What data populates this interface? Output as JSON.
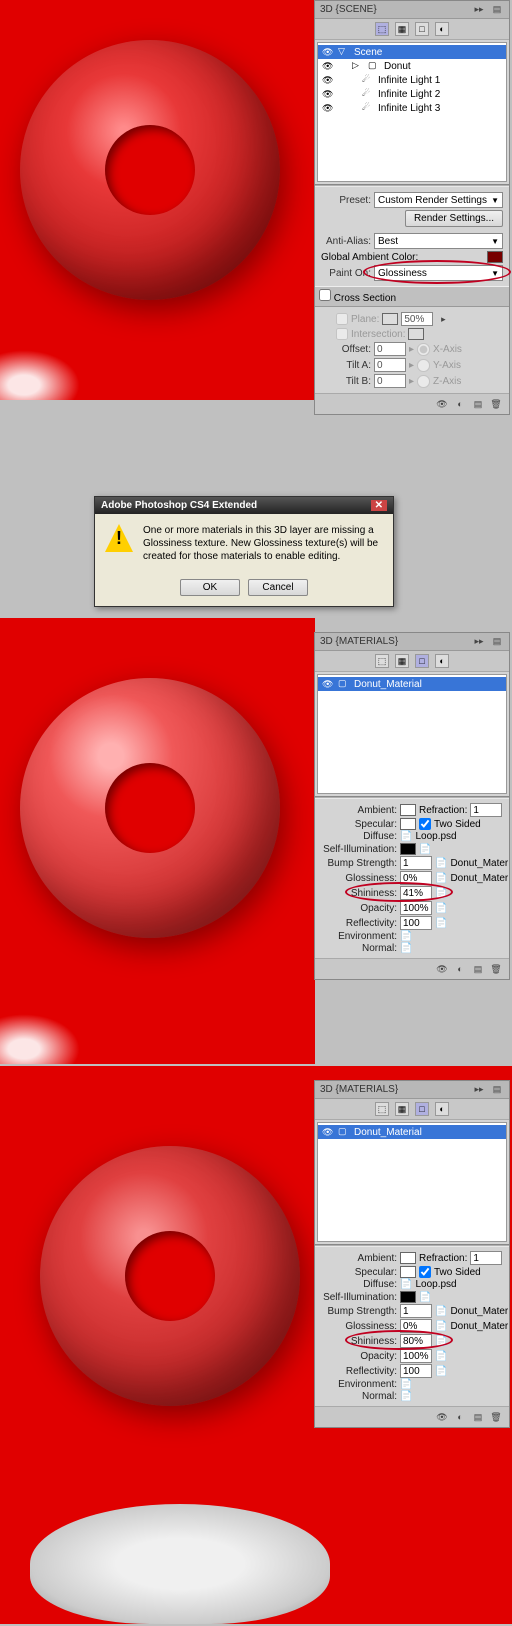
{
  "scene_panel": {
    "title": "3D {SCENE}",
    "tree": [
      {
        "name": "Scene",
        "selected": true,
        "indent": 0,
        "expand": "▽"
      },
      {
        "name": "Donut",
        "indent": 1,
        "expand": "▷"
      },
      {
        "name": "Infinite Light 1",
        "indent": 1,
        "icon": "light"
      },
      {
        "name": "Infinite Light 2",
        "indent": 1,
        "icon": "light"
      },
      {
        "name": "Infinite Light 3",
        "indent": 1,
        "icon": "light"
      }
    ],
    "preset_label": "Preset:",
    "preset_value": "Custom Render Settings",
    "render_settings_btn": "Render Settings...",
    "anti_alias_label": "Anti-Alias:",
    "anti_alias_value": "Best",
    "global_ambient_label": "Global Ambient Color:",
    "global_ambient_color": "#770000",
    "paint_on_label": "Paint On:",
    "paint_on_value": "Glossiness",
    "cross_section_label": "Cross Section",
    "plane_label": "Plane:",
    "plane_pct": "50%",
    "intersection_label": "Intersection:",
    "offset_label": "Offset:",
    "offset_value": "0",
    "x_axis": "X-Axis",
    "tilt_a_label": "Tilt A:",
    "tilt_a_value": "0",
    "y_axis": "Y-Axis",
    "tilt_b_label": "Tilt B:",
    "tilt_b_value": "0",
    "z_axis": "Z-Axis"
  },
  "dialog": {
    "title": "Adobe Photoshop CS4 Extended",
    "message": "One or more materials in this 3D layer are missing a Glossiness texture. New Glossiness texture(s) will be created for those materials to enable editing.",
    "ok": "OK",
    "cancel": "Cancel"
  },
  "materials_panel": {
    "title": "3D {MATERIALS}",
    "material_name": "Donut_Material",
    "ambient_label": "Ambient:",
    "refraction_label": "Refraction:",
    "refraction_value": "1",
    "specular_label": "Specular:",
    "two_sided_label": "Two Sided",
    "diffuse_label": "Diffuse:",
    "diffuse_file": "Loop.psd",
    "self_illum_label": "Self-Illumination:",
    "bump_label": "Bump Strength:",
    "bump_value": "1",
    "bump_file": "Donut_Mater",
    "glossiness_label": "Glossiness:",
    "glossiness_value": "0%",
    "glossiness_file": "Donut_Mater",
    "shininess_label": "Shininess:",
    "opacity_label": "Opacity:",
    "opacity_value": "100%",
    "reflectivity_label": "Reflectivity:",
    "reflectivity_value": "100",
    "environment_label": "Environment:",
    "normal_label": "Normal:"
  },
  "shininess_1": "41%",
  "shininess_2": "80%"
}
